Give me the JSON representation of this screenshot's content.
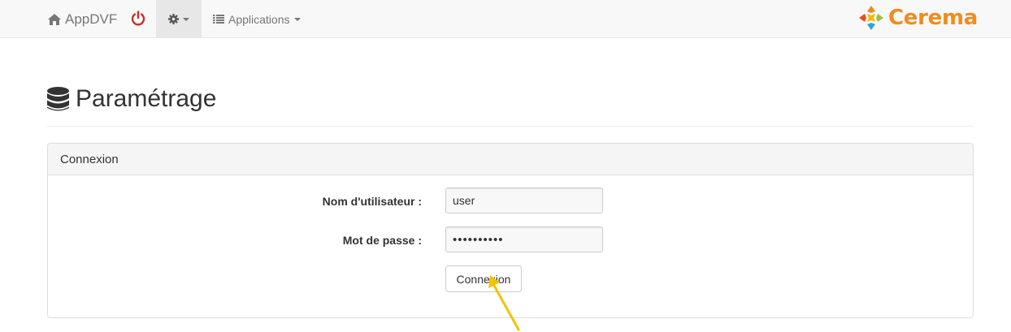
{
  "navbar": {
    "brand": "AppDVF",
    "applications_label": "Applications",
    "logo_text": "Cerema"
  },
  "page": {
    "title": "Paramétrage"
  },
  "panel": {
    "heading": "Connexion",
    "username_label": "Nom d'utilisateur :",
    "username_value": "user",
    "password_label": "Mot de passe :",
    "password_value": "••••••••••",
    "submit_label": "Connexion"
  },
  "colors": {
    "logo_orange": "#f18b1f",
    "power_red": "#c9302c",
    "arrow_yellow": "#f5c200"
  }
}
